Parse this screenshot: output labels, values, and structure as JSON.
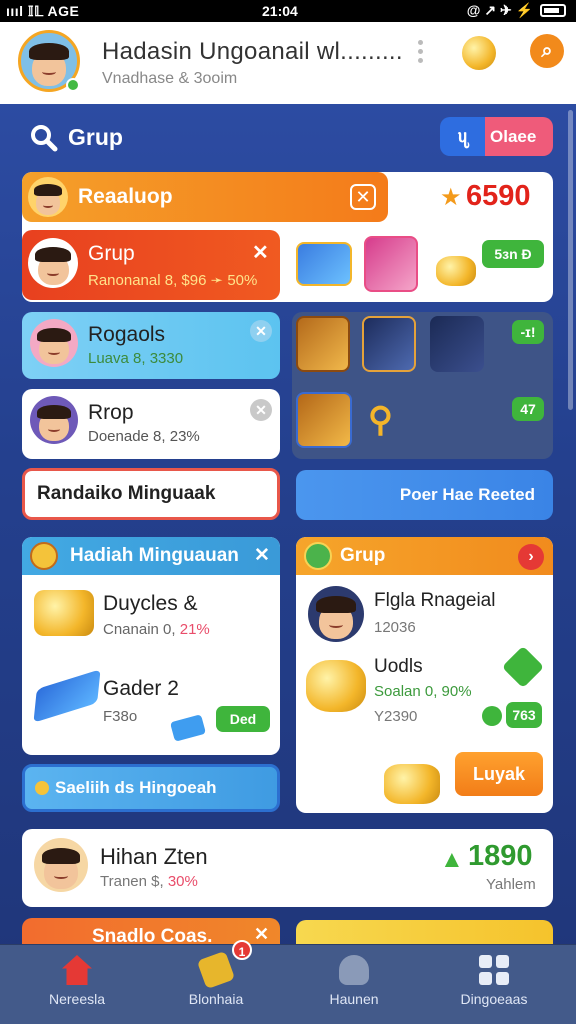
{
  "status_bar": {
    "left": "ıııl 𝕀𝕃 AGE",
    "time": "21:04",
    "icons": "@ ↗ ✈ ⚡"
  },
  "header": {
    "title": "Hadasin Ungoanail wl.........",
    "subtitle": "Vnadhase & 3ooim"
  },
  "search": {
    "label": "Grup",
    "button_label": "Olaee"
  },
  "top_section": {
    "band_title": "Reaaluop",
    "score": "6590",
    "rows": [
      {
        "title": "Grup",
        "subtitle": "Ranonanal 8, $96 ➛ 50%"
      },
      {
        "title": "Rogaols",
        "subtitle": "Luava 8, 3330"
      },
      {
        "title": "Rrop",
        "subtitle": "Doenade 8, 23%"
      }
    ],
    "pill_1": "5ɜn Ð",
    "pill_2": "-ɪ!",
    "pill_3": "47"
  },
  "buttons": {
    "outline": "Randaiko Minguaak",
    "blue": "Poer Hae Reeted"
  },
  "left_panel": {
    "title": "Hadiah Minguauan",
    "items": [
      {
        "title": "Duycles &",
        "subtitle": "Cnanain 0, ",
        "percent": "21%"
      },
      {
        "title": "Gader 2",
        "subtitle": "F38o",
        "action": "Ded"
      }
    ]
  },
  "right_panel": {
    "title": "Grup",
    "items": [
      {
        "title": "Flgla Rnageial",
        "subtitle": "12036"
      },
      {
        "title": "Uodls",
        "subtitle": "Soalan 0, 90%",
        "extra": "Y2390",
        "pill": "763"
      }
    ],
    "action_button": "Luyak"
  },
  "promo": {
    "label": "Saeliih ds Hingoeah"
  },
  "bottom_card": {
    "title": "Hihan Zten",
    "subtitle": "Tranen $, ",
    "percent": "30%",
    "score": "1890",
    "score_label": "Yahlem"
  },
  "peek": {
    "left": "Snadlo Coas.",
    "close": "✕"
  },
  "nav": {
    "items": [
      {
        "label": "Nereesla"
      },
      {
        "label": "Blonhaia",
        "badge": "1"
      },
      {
        "label": "Haunen"
      },
      {
        "label": "Dingoeaas"
      }
    ]
  },
  "colors": {
    "accent_orange": "#f47b1a",
    "accent_blue": "#3a84e6",
    "accent_green": "#3fb53c",
    "score_red": "#e2231a"
  }
}
